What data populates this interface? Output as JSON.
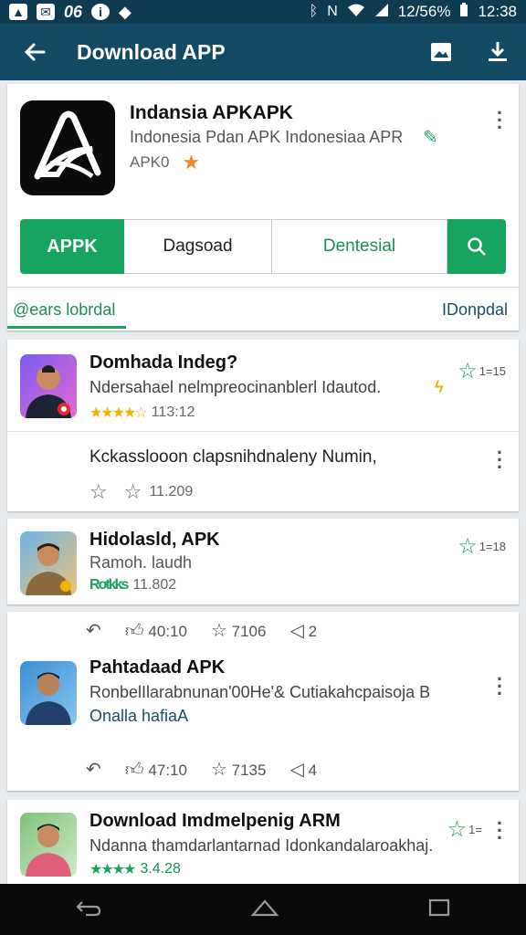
{
  "status_bar": {
    "left_text": "06",
    "battery_text": "12/56%",
    "time": "12:38"
  },
  "app_bar": {
    "title": "Download APP"
  },
  "header": {
    "app_name": "Indansia APKAPK",
    "description": "Indonesia Pdan APK Indonesiaa APR",
    "rating_label": "APK0",
    "buttons": {
      "apk": "APPK",
      "download": "Dagsoad",
      "dentesial": "Dentesial"
    },
    "tabs": {
      "left": "@ears lobrdal",
      "right": "IDonpdal"
    }
  },
  "items": [
    {
      "title": "Domhada Indeg?",
      "subtitle": "Ndersahael nelmpreocinanblerl Idautod.",
      "rating_value": "113:12",
      "side_label": "1=15"
    },
    {
      "subtitle": "Kckasslooon clapsnihdnaleny Numin,",
      "rating_value": "11.209"
    },
    {
      "title": "Hidolasld, APK",
      "subtitle": "Ramoh. laudh",
      "rating_prefix": "Rotkks",
      "rating_value": "11.802",
      "side_label": "1=18"
    },
    {
      "title": "Pahtadaad APK",
      "subtitle": "RonbelIlarabnunan'00He'& Cutiakahcpaisoja B",
      "subtitle2": "Onalla hafiaA",
      "top_actions": {
        "time": "40:10",
        "count": "7106",
        "shares": "2"
      },
      "bottom_actions": {
        "time": "47:10",
        "count": "7135",
        "shares": "4"
      }
    },
    {
      "title": "Download Imdmelpenig ARM",
      "subtitle": "Ndanna thamdarlantarnad Idonkandalaroakhaj.",
      "rating_value": "3.4.28",
      "side_label": "1="
    }
  ]
}
